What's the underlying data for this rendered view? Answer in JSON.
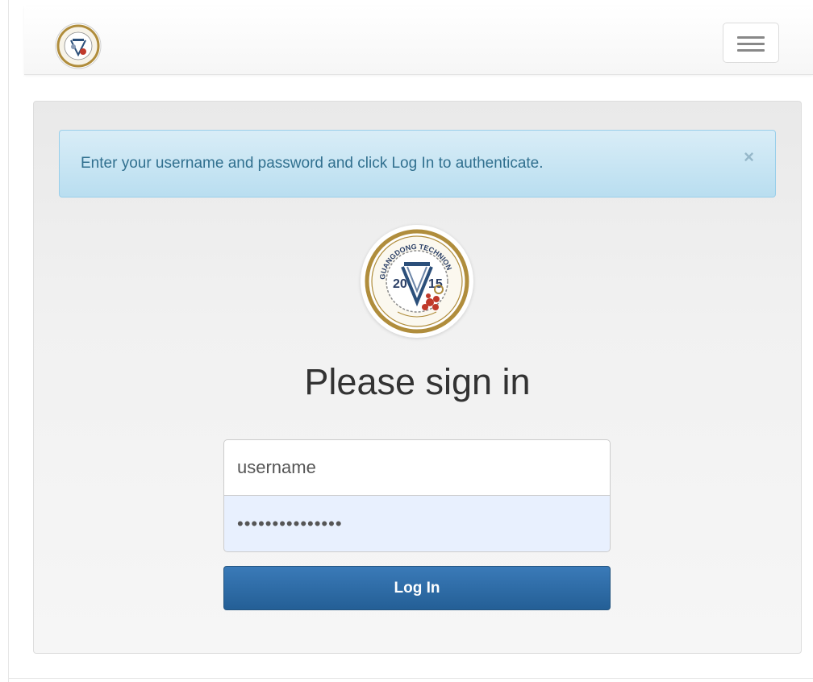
{
  "navbar": {
    "logo_icon": "university-seal-icon",
    "toggle_icon": "hamburger-menu-icon"
  },
  "alert": {
    "message": "Enter your username and password and click Log In to authenticate.",
    "close_label": "×"
  },
  "seal": {
    "icon": "university-seal-icon",
    "year_left": "20",
    "year_right": "15",
    "arc_text": "GUANGDONG TECHNION"
  },
  "login": {
    "heading": "Please sign in",
    "username_value": "username",
    "password_value": "•••••••••••••••",
    "submit_label": "Log In"
  },
  "colors": {
    "alert_text": "#31708f",
    "alert_bg": "#d9edf7",
    "button_bg": "#2e6da4",
    "password_autofill_bg": "#e8f0fe",
    "seal_gold": "#b08d3c",
    "seal_red": "#c0392b"
  }
}
